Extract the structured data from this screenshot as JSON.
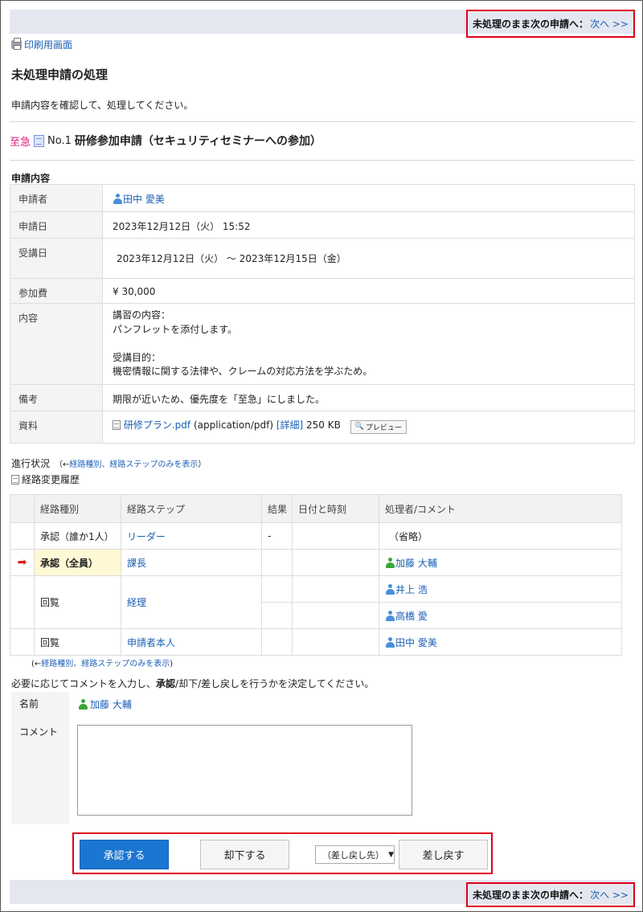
{
  "nav": {
    "label": "未処理のまま次の申請へ：",
    "next_label": "次へ >>"
  },
  "print_label": "印刷用画面",
  "page_title": "未処理申請の処理",
  "instruction": "申請内容を確認して、処理してください。",
  "request": {
    "priority": "至急",
    "number": "No.1",
    "title": "研修参加申請（セキュリティセミナーへの参加）"
  },
  "details_section_label": "申請内容",
  "details": {
    "applicant": {
      "label": "申請者",
      "value": "田中 愛美"
    },
    "apply_date": {
      "label": "申請日",
      "value": "2023年12月12日（火） 15:52"
    },
    "course_date": {
      "label": "受講日",
      "value": "2023年12月12日（火） 〜 2023年12月15日（金）"
    },
    "fee": {
      "label": "参加費",
      "value": "¥ 30,000"
    },
    "content": {
      "label": "内容",
      "lines": [
        "講習の内容：",
        "パンフレットを添付します。",
        "",
        "受講目的：",
        "機密情報に関する法律や、クレームの対応方法を学ぶため。"
      ]
    },
    "remarks": {
      "label": "備考",
      "value": "期限が近いため、優先度を「至急」にしました。"
    },
    "attachment": {
      "label": "資料",
      "file_name": "研修プラン.pdf",
      "mime": "(application/pdf)",
      "detail_link": "[詳細]",
      "size": "250 KB",
      "preview_label": "プレビュー"
    }
  },
  "progress": {
    "title": "進行状況",
    "filter_prefix": "（←",
    "filter_link": "経路種別、経路ステップのみを表示",
    "filter_suffix": "）",
    "history_label": "経路変更履歴",
    "columns": [
      "経路種別",
      "経路ステップ",
      "結果",
      "日付と時刻",
      "処理者/コメント"
    ],
    "rows": [
      {
        "type": "承認（誰か1人）",
        "step": "リーダー",
        "result": "-",
        "datetime": "",
        "processors": [
          "（省略）"
        ],
        "current": false
      },
      {
        "type": "承認（全員）",
        "step": "課長",
        "result": "",
        "datetime": "",
        "processors": [
          "加藤 大輔"
        ],
        "current": true
      },
      {
        "type": "回覧",
        "step": "経理",
        "result": "",
        "datetime": "",
        "processors": [
          "井上 浩",
          "高橋 愛"
        ],
        "current": false
      },
      {
        "type": "回覧",
        "step": "申請者本人",
        "result": "",
        "datetime": "",
        "processors": [
          "田中 愛美"
        ],
        "current": false
      }
    ],
    "bottom_filter_prefix": "(←",
    "bottom_filter_link": "経路種別、経路ステップのみを表示",
    "bottom_filter_suffix": ")"
  },
  "decision": {
    "instruction_pre": "必要に応じてコメントを入力し、",
    "instruction_bold": "承認",
    "instruction_post": "/却下/差し戻しを行うかを決定してください。",
    "name_label": "名前",
    "name_value": "加藤 大輔",
    "comment_label": "コメント",
    "comment_value": "",
    "approve_label": "承認する",
    "reject_label": "却下する",
    "return_target": "（差し戻し先）",
    "return_label": "差し戻す"
  },
  "colors": {
    "accent": "#1b76d2",
    "highlight_border": "#e0001a",
    "urgent": "#e0197d",
    "current_step_bg": "#fff8d4",
    "nav_bar_bg": "#e4e7f0"
  }
}
